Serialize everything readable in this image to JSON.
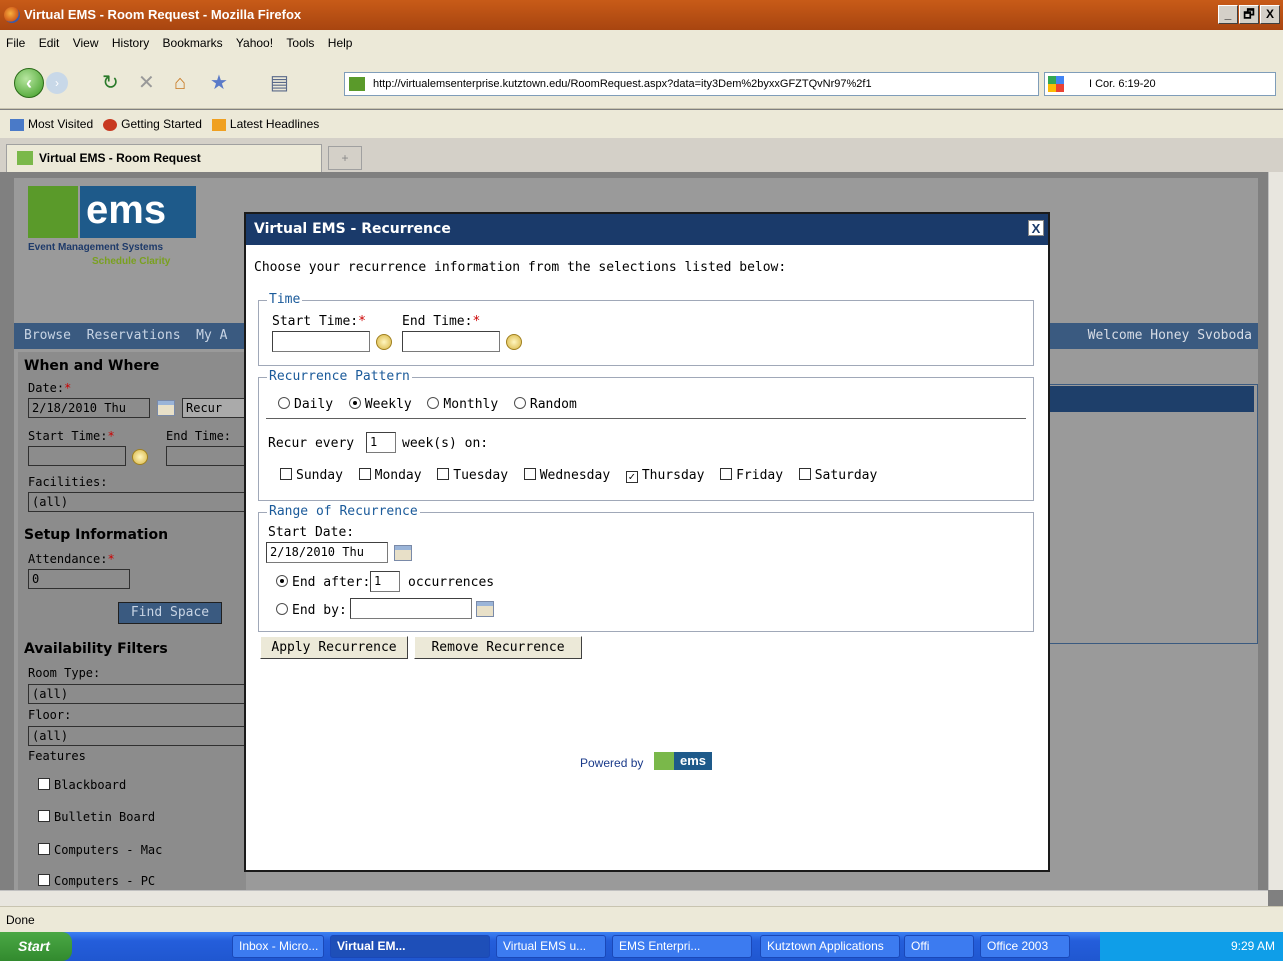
{
  "window": {
    "title": "Virtual EMS - Room Request - Mozilla Firefox",
    "controls": [
      "_",
      "🗗",
      "X"
    ]
  },
  "menu": [
    "File",
    "Edit",
    "View",
    "History",
    "Bookmarks",
    "Yahoo!",
    "Tools",
    "Help"
  ],
  "url": "http://virtualemsenterprise.kutztown.edu/RoomRequest.aspx?data=ity3Dem%2byxxGFZTQvNr97%2f1",
  "search_value": "I Cor. 6:19-20",
  "bookmarks": [
    "Most Visited",
    "Getting Started",
    "Latest Headlines"
  ],
  "tab_label": "Virtual EMS - Room Request",
  "page": {
    "logo_text": "ems",
    "logo_sub1": "Event Management Systems",
    "logo_sub2": "Schedule Clarity",
    "nav_text": "Browse  Reservations  My A",
    "welcome": "Welcome Honey Svoboda",
    "when_where": "When and Where",
    "date_label": "Date:",
    "date_value": "2/18/2010 Thu",
    "recur_btn": "Recur",
    "start_time_label": "Start Time:",
    "end_time_label": "End Time:",
    "facilities_label": "Facilities:",
    "facilities_value": "(all)",
    "setup_info": "Setup Information",
    "attendance_label": "Attendance:",
    "attendance_value": "0",
    "find_space": "Find Space",
    "avail_filters": "Availability Filters",
    "room_type_label": "Room Type:",
    "room_type_value": "(all)",
    "floor_label": "Floor:",
    "floor_value": "(all)",
    "features_label": "Features",
    "features": [
      "Blackboard",
      "Bulletin Board",
      "Computers - Mac",
      "Computers - PC"
    ]
  },
  "modal": {
    "title": "Virtual EMS - Recurrence",
    "close": "X",
    "intro": "Choose your recurrence information from the selections listed below:",
    "time_legend": "Time",
    "start_time_label": "Start Time:",
    "end_time_label": "End Time:",
    "required_mark": "*",
    "pattern_legend": "Recurrence Pattern",
    "patterns": [
      "Daily",
      "Weekly",
      "Monthly",
      "Random"
    ],
    "selected_pattern": "Weekly",
    "recur_every_label": "Recur every",
    "recur_every_value": "1",
    "recur_every_suffix": "week(s) on:",
    "days": [
      "Sunday",
      "Monday",
      "Tuesday",
      "Wednesday",
      "Thursday",
      "Friday",
      "Saturday"
    ],
    "checked_days": [
      "Thursday"
    ],
    "range_legend": "Range of Recurrence",
    "start_date_label": "Start Date:",
    "start_date_value": "2/18/2010 Thu",
    "end_after_label": "End after:",
    "end_after_value": "1",
    "occurrences_label": "occurrences",
    "end_by_label": "End by:",
    "apply_btn": "Apply Recurrence",
    "remove_btn": "Remove Recurrence",
    "powered_by": "Powered by",
    "powered_logo": "ems"
  },
  "status": "Done",
  "taskbar": {
    "start": "Start",
    "items": [
      "Inbox - Micro...",
      "Virtual EM...",
      "Virtual EMS u...",
      "EMS Enterpri...",
      "Kutztown Applications",
      "Offi",
      "Office 2003"
    ],
    "time": "9:29 AM"
  }
}
